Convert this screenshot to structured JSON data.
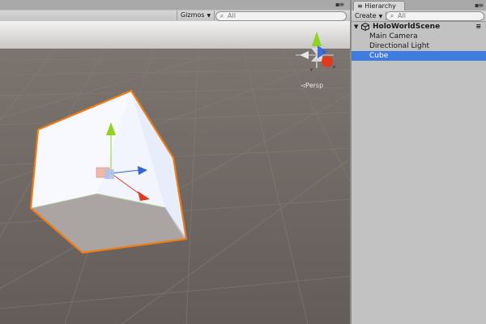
{
  "scene_view": {
    "gizmos_label": "Gizmos",
    "search_placeholder": "All",
    "projection_label": "Persp",
    "colors": {
      "ground": "#6b625d",
      "cube_top": "#f7f9ff",
      "cube_side": "#e3eaf8",
      "cube_bottom": "#a9a4a1",
      "selection_outline": "#f07c15",
      "axis_x": "#e0391d",
      "axis_y": "#8fd21f",
      "axis_z": "#2f63d9"
    }
  },
  "hierarchy": {
    "tab_label": "Hierarchy",
    "create_label": "Create",
    "search_placeholder": "All",
    "scene_name": "HoloWorldScene",
    "items": [
      {
        "label": "Main Camera",
        "selected": false
      },
      {
        "label": "Directional Light",
        "selected": false
      },
      {
        "label": "Cube",
        "selected": true
      }
    ],
    "selection_color": "#3e7ce0"
  }
}
